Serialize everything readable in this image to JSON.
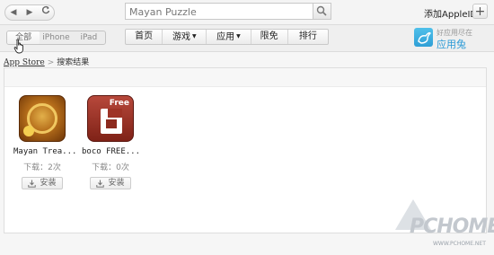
{
  "toolbar": {
    "back_icon": "chevron-left-icon",
    "forward_icon": "chevron-right-icon",
    "refresh_icon": "refresh-icon",
    "search": {
      "value": "Mayan Puzzle",
      "icon": "search-icon"
    },
    "add_apple_id": "添加AppleID",
    "plus": "+"
  },
  "device_tabs": [
    {
      "label": "全部",
      "active": true
    },
    {
      "label": "iPhone",
      "active": false
    },
    {
      "label": "iPad",
      "active": false
    }
  ],
  "nav": [
    {
      "label": "首页"
    },
    {
      "label": "游戏",
      "caret": true
    },
    {
      "label": "应用",
      "caret": true
    },
    {
      "label": "限免"
    },
    {
      "label": "排行"
    }
  ],
  "promo": {
    "line1": "好应用尽在",
    "line2": "应用兔"
  },
  "breadcrumb": {
    "root": "App Store",
    "separator": ">",
    "current": "搜索结果"
  },
  "results": [
    {
      "name": "Mayan Trea...",
      "downloads": "下载：2次",
      "install": "安装"
    },
    {
      "name": "boco FREE...",
      "downloads": "下载：0次",
      "install": "安装",
      "badge": "Free"
    }
  ],
  "watermark": {
    "text": "PCHOME",
    "url": "WWW.PCHOME.NET"
  },
  "colors": {
    "accent": "#2a9ad6",
    "background": "#f6f6f6"
  }
}
